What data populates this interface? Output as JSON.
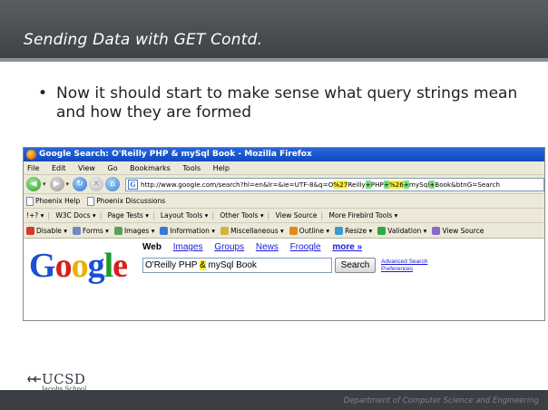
{
  "slide": {
    "title": "Sending Data with GET Contd.",
    "bullet": "Now it should start to make sense what query strings mean and how they are formed",
    "footer": "Department of Computer Science and Engineering",
    "logo_text": "UCSD",
    "logo_sub": "Jacobs School"
  },
  "browser": {
    "window_title": "Google Search: O'Reilly PHP & mySql Book - Mozilla Firefox",
    "menu": [
      "File",
      "Edit",
      "View",
      "Go",
      "Bookmarks",
      "Tools",
      "Help"
    ],
    "url": {
      "part1": "http://www.google.com/search?hl=en&lr=&ie=UTF-8&q=O",
      "hl1": "%27",
      "part2": "Reilly",
      "hl2": "+",
      "part3": "PHP",
      "hl3": "+",
      "hl4": "%26",
      "hl5": "+",
      "part4": "mySql",
      "hl6": "+",
      "part5": "Book&btnG=Search"
    },
    "bookmarks": [
      "Phoenix Help",
      "Phoenix Discussions"
    ],
    "toolbar1": [
      "!+? ▾",
      "W3C Docs ▾",
      "Page Tests ▾",
      "Layout Tools ▾",
      "Other Tools ▾",
      "View Source",
      "More Firebird Tools ▾"
    ],
    "toolbar2": [
      {
        "label": "Disable ▾",
        "icon": "disable-icon",
        "color": "#d43a2a"
      },
      {
        "label": "Forms ▾",
        "icon": "forms-icon",
        "color": "#6b8cc4"
      },
      {
        "label": "Images ▾",
        "icon": "images-icon",
        "color": "#5aa05a"
      },
      {
        "label": "Information ▾",
        "icon": "information-icon",
        "color": "#3a78d4"
      },
      {
        "label": "Miscellaneous ▾",
        "icon": "miscellaneous-icon",
        "color": "#d4b43a"
      },
      {
        "label": "Outline ▾",
        "icon": "outline-icon",
        "color": "#e08a1a"
      },
      {
        "label": "Resize ▾",
        "icon": "resize-icon",
        "color": "#3a9ad4"
      },
      {
        "label": "Validation ▾",
        "icon": "validation-icon",
        "color": "#2ea84a"
      },
      {
        "label": "View Source",
        "icon": "view-source-icon",
        "color": "#8a6ac4"
      }
    ]
  },
  "google": {
    "logo": "Google",
    "tab_web": "Web",
    "tabs": [
      "Images",
      "Groups",
      "News",
      "Froogle"
    ],
    "more": "more »",
    "query_a": "O'Reilly PHP ",
    "query_amp": "&",
    "query_b": " mySql Book",
    "button": "Search",
    "advanced": "Advanced Search",
    "preferences": "Preferences"
  },
  "colors": {
    "title_bar": "#4a4d52",
    "highlight_yellow": "#ffee33",
    "highlight_green": "#7ee07e",
    "link_blue": "#1a1ad8"
  }
}
